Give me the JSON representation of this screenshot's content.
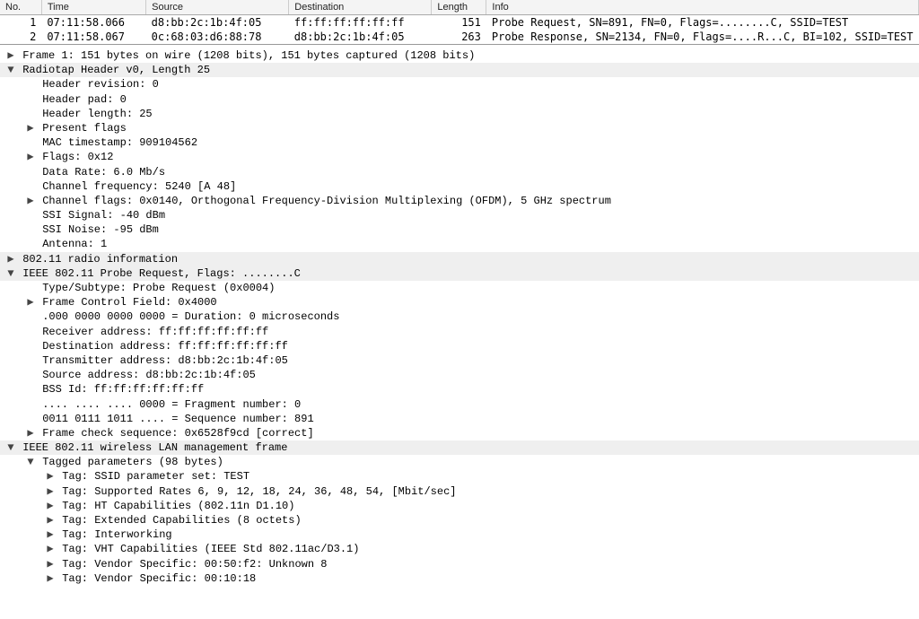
{
  "columns": {
    "no": "No.",
    "time": "Time",
    "source": "Source",
    "destination": "Destination",
    "length": "Length",
    "info": "Info"
  },
  "packets": [
    {
      "no": "1",
      "time": "07:11:58.066",
      "source": "d8:bb:2c:1b:4f:05",
      "destination": "ff:ff:ff:ff:ff:ff",
      "length": "151",
      "info": "Probe Request, SN=891, FN=0, Flags=........C, SSID=TEST"
    },
    {
      "no": "2",
      "time": "07:11:58.067",
      "source": "0c:68:03:d6:88:78",
      "destination": "d8:bb:2c:1b:4f:05",
      "length": "263",
      "info": "Probe Response, SN=2134, FN=0, Flags=....R...C, BI=102, SSID=TEST"
    }
  ],
  "tree": [
    {
      "toggle": "closed",
      "indent": 0,
      "section": false,
      "text": "Frame 1: 151 bytes on wire (1208 bits), 151 bytes captured (1208 bits)"
    },
    {
      "toggle": "open",
      "indent": 0,
      "section": true,
      "text": "Radiotap Header v0, Length 25"
    },
    {
      "toggle": "none",
      "indent": 1,
      "section": false,
      "text": "Header revision: 0"
    },
    {
      "toggle": "none",
      "indent": 1,
      "section": false,
      "text": "Header pad: 0"
    },
    {
      "toggle": "none",
      "indent": 1,
      "section": false,
      "text": "Header length: 25"
    },
    {
      "toggle": "closed",
      "indent": 1,
      "section": false,
      "text": "Present flags"
    },
    {
      "toggle": "none",
      "indent": 1,
      "section": false,
      "text": "MAC timestamp: 909104562"
    },
    {
      "toggle": "closed",
      "indent": 1,
      "section": false,
      "text": "Flags: 0x12"
    },
    {
      "toggle": "none",
      "indent": 1,
      "section": false,
      "text": "Data Rate: 6.0 Mb/s"
    },
    {
      "toggle": "none",
      "indent": 1,
      "section": false,
      "text": "Channel frequency: 5240 [A 48]"
    },
    {
      "toggle": "closed",
      "indent": 1,
      "section": false,
      "text": "Channel flags: 0x0140, Orthogonal Frequency-Division Multiplexing (OFDM), 5 GHz spectrum"
    },
    {
      "toggle": "none",
      "indent": 1,
      "section": false,
      "text": "SSI Signal: -40 dBm"
    },
    {
      "toggle": "none",
      "indent": 1,
      "section": false,
      "text": "SSI Noise: -95 dBm"
    },
    {
      "toggle": "none",
      "indent": 1,
      "section": false,
      "text": "Antenna: 1"
    },
    {
      "toggle": "closed",
      "indent": 0,
      "section": true,
      "text": "802.11 radio information"
    },
    {
      "toggle": "open",
      "indent": 0,
      "section": true,
      "text": "IEEE 802.11 Probe Request, Flags: ........C"
    },
    {
      "toggle": "none",
      "indent": 1,
      "section": false,
      "text": "Type/Subtype: Probe Request (0x0004)"
    },
    {
      "toggle": "closed",
      "indent": 1,
      "section": false,
      "text": "Frame Control Field: 0x4000"
    },
    {
      "toggle": "none",
      "indent": 1,
      "section": false,
      "text": ".000 0000 0000 0000 = Duration: 0 microseconds"
    },
    {
      "toggle": "none",
      "indent": 1,
      "section": false,
      "text": "Receiver address: ff:ff:ff:ff:ff:ff"
    },
    {
      "toggle": "none",
      "indent": 1,
      "section": false,
      "text": "Destination address: ff:ff:ff:ff:ff:ff"
    },
    {
      "toggle": "none",
      "indent": 1,
      "section": false,
      "text": "Transmitter address: d8:bb:2c:1b:4f:05"
    },
    {
      "toggle": "none",
      "indent": 1,
      "section": false,
      "text": "Source address: d8:bb:2c:1b:4f:05"
    },
    {
      "toggle": "none",
      "indent": 1,
      "section": false,
      "text": "BSS Id: ff:ff:ff:ff:ff:ff"
    },
    {
      "toggle": "none",
      "indent": 1,
      "section": false,
      "text": ".... .... .... 0000 = Fragment number: 0"
    },
    {
      "toggle": "none",
      "indent": 1,
      "section": false,
      "text": "0011 0111 1011 .... = Sequence number: 891"
    },
    {
      "toggle": "closed",
      "indent": 1,
      "section": false,
      "text": "Frame check sequence: 0x6528f9cd [correct]"
    },
    {
      "toggle": "open",
      "indent": 0,
      "section": true,
      "text": "IEEE 802.11 wireless LAN management frame"
    },
    {
      "toggle": "open",
      "indent": 1,
      "section": false,
      "text": "Tagged parameters (98 bytes)"
    },
    {
      "toggle": "closed",
      "indent": 2,
      "section": false,
      "text": "Tag: SSID parameter set: TEST"
    },
    {
      "toggle": "closed",
      "indent": 2,
      "section": false,
      "text": "Tag: Supported Rates 6, 9, 12, 18, 24, 36, 48, 54, [Mbit/sec]"
    },
    {
      "toggle": "closed",
      "indent": 2,
      "section": false,
      "text": "Tag: HT Capabilities (802.11n D1.10)"
    },
    {
      "toggle": "closed",
      "indent": 2,
      "section": false,
      "text": "Tag: Extended Capabilities (8 octets)"
    },
    {
      "toggle": "closed",
      "indent": 2,
      "section": false,
      "text": "Tag: Interworking"
    },
    {
      "toggle": "closed",
      "indent": 2,
      "section": false,
      "text": "Tag: VHT Capabilities (IEEE Std 802.11ac/D3.1)"
    },
    {
      "toggle": "closed",
      "indent": 2,
      "section": false,
      "text": "Tag: Vendor Specific: 00:50:f2: Unknown 8"
    },
    {
      "toggle": "closed",
      "indent": 2,
      "section": false,
      "text": "Tag: Vendor Specific: 00:10:18"
    }
  ]
}
